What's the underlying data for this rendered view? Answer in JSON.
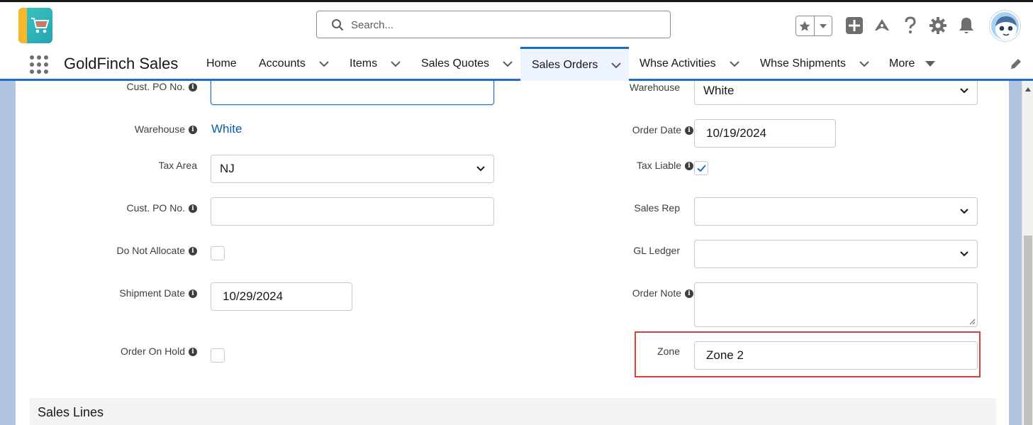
{
  "header": {
    "logo_icon": "goldfinch-cart-logo",
    "search_placeholder": "Search...",
    "icons": [
      "star-icon",
      "chevron-down-icon",
      "plus-icon",
      "trailhead-icon",
      "help-icon",
      "setup-gear-icon",
      "notification-bell-icon",
      "user-avatar"
    ]
  },
  "nav": {
    "app_name": "GoldFinch Sales",
    "tabs": [
      {
        "label": "Home",
        "has_menu": false
      },
      {
        "label": "Accounts",
        "has_menu": true
      },
      {
        "label": "Items",
        "has_menu": true
      },
      {
        "label": "Sales Quotes",
        "has_menu": true
      },
      {
        "label": "Sales Orders",
        "has_menu": true,
        "active": true
      },
      {
        "label": "Whse Activities",
        "has_menu": true
      },
      {
        "label": "Whse Shipments",
        "has_menu": true
      },
      {
        "label": "More",
        "has_menu": true
      }
    ]
  },
  "form": {
    "left": {
      "cust_po_top": {
        "label": "Cust. PO No.",
        "value": ""
      },
      "warehouse": {
        "label": "Warehouse",
        "value": "White"
      },
      "tax_area": {
        "label": "Tax Area",
        "value": "NJ"
      },
      "cust_po": {
        "label": "Cust. PO No.",
        "value": ""
      },
      "do_not_allocate": {
        "label": "Do Not Allocate",
        "checked": false
      },
      "shipment_date": {
        "label": "Shipment Date",
        "value": "10/29/2024"
      },
      "order_on_hold": {
        "label": "Order On Hold",
        "checked": false
      }
    },
    "right": {
      "warehouse": {
        "label": "Warehouse",
        "value": "White"
      },
      "order_date": {
        "label": "Order Date",
        "value": "10/19/2024"
      },
      "tax_liable": {
        "label": "Tax Liable",
        "checked": true
      },
      "sales_rep": {
        "label": "Sales Rep",
        "value": ""
      },
      "gl_ledger": {
        "label": "GL Ledger",
        "value": ""
      },
      "order_note": {
        "label": "Order Note",
        "value": ""
      },
      "zone": {
        "label": "Zone",
        "value": "Zone 2"
      }
    }
  },
  "sections": {
    "sales_lines": "Sales Lines"
  },
  "colors": {
    "accent": "#1b6ec2",
    "highlight": "#d9413f",
    "link": "#0b5cab",
    "background": "#b0c4df"
  }
}
